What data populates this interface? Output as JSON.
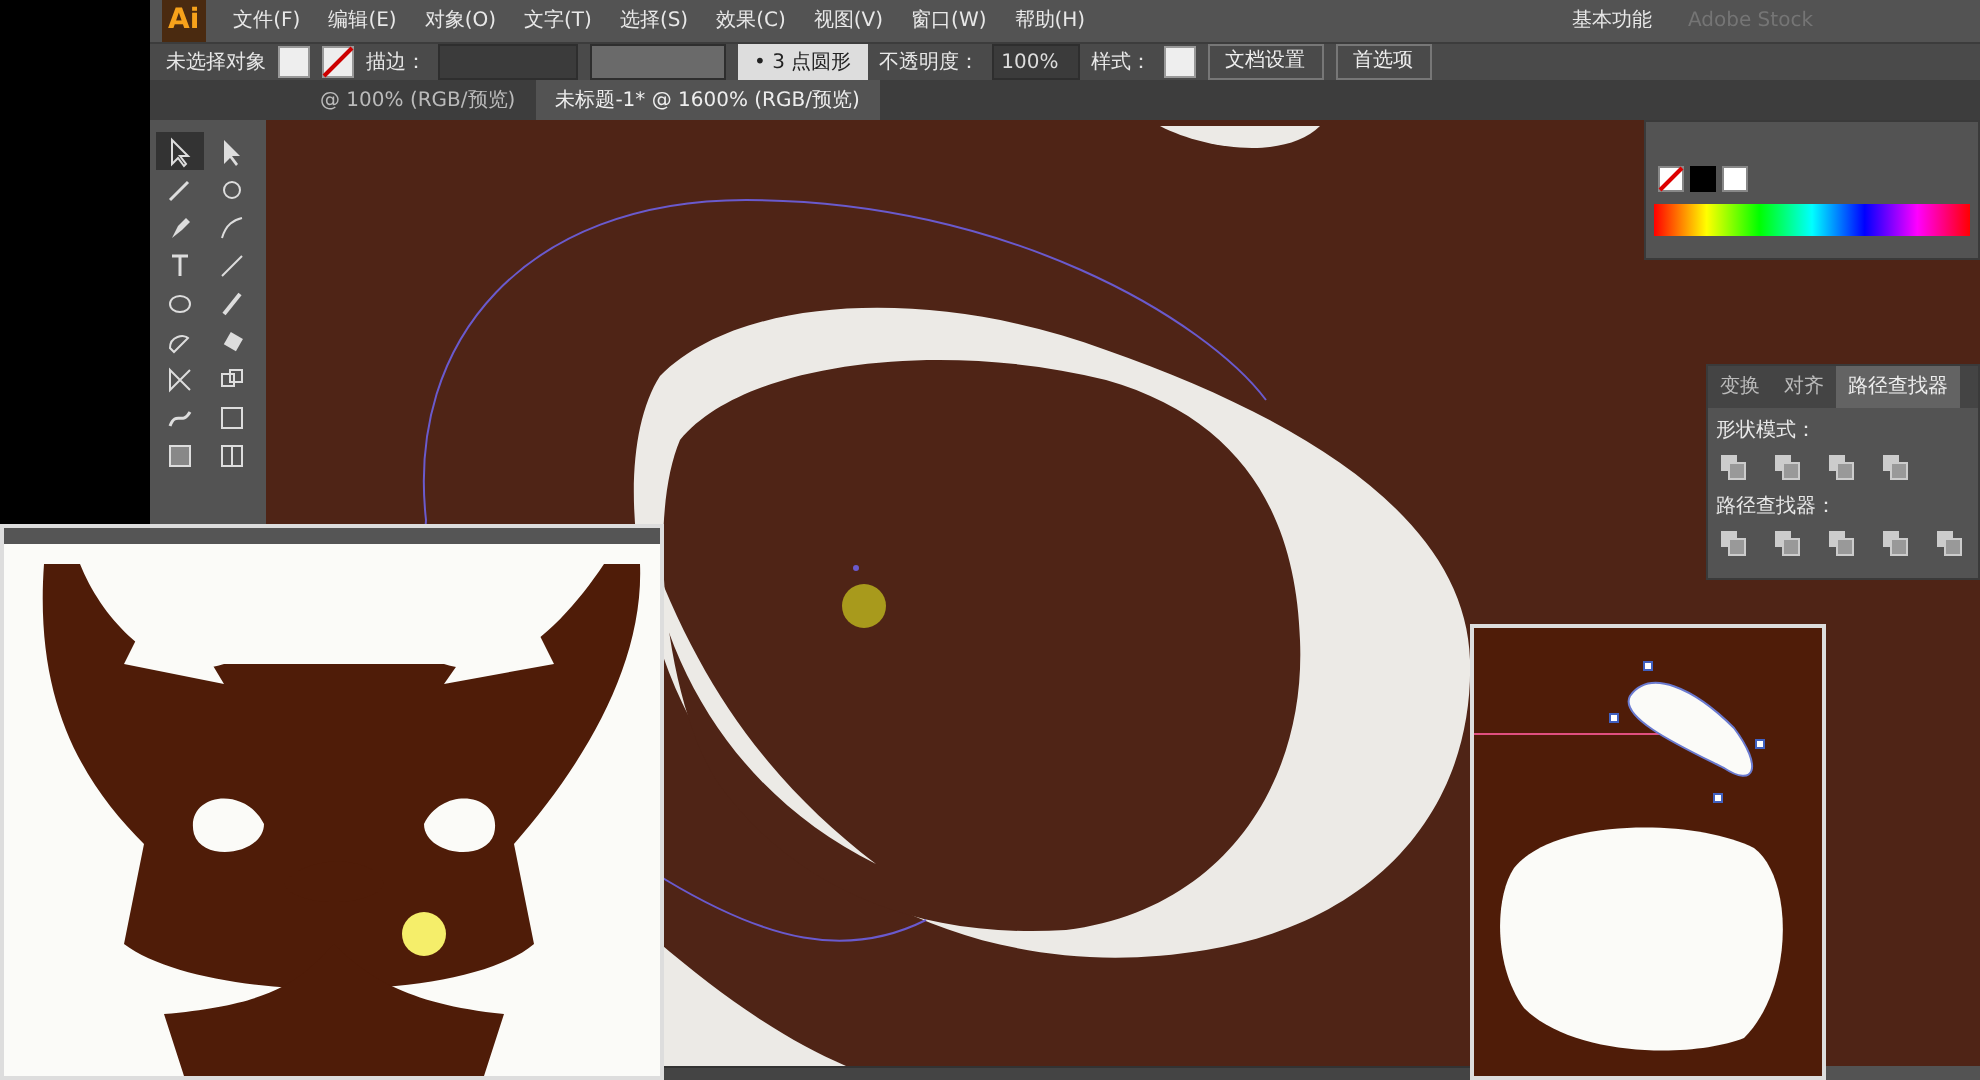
{
  "logo": "Ai",
  "menu": [
    "文件(F)",
    "编辑(E)",
    "对象(O)",
    "文字(T)",
    "选择(S)",
    "效果(C)",
    "视图(V)",
    "窗口(W)",
    "帮助(H)"
  ],
  "workspace": "基本功能",
  "search": {
    "placeholder": "Adobe Stock"
  },
  "control_bar": {
    "selection": "未选择对象",
    "stroke_label": "描边：",
    "brush": "• 3 点圆形",
    "opacity_label": "不透明度：",
    "opacity": "100%",
    "style_label": "样式：",
    "buttons": [
      "文档设置",
      "首选项"
    ]
  },
  "tabs": [
    {
      "label": "@ 100% (RGB/预览)",
      "selected": false
    },
    {
      "label": "未标题-1* @ 1600% (RGB/预览)",
      "selected": true
    }
  ],
  "tools": [
    {
      "selected": true
    },
    {
      "selected": false
    },
    {
      "selected": false
    },
    {
      "selected": false
    },
    {
      "selected": false
    },
    {
      "selected": false
    },
    {
      "selected": false
    },
    {
      "selected": false
    },
    {
      "selected": false
    },
    {
      "selected": false
    },
    {
      "selected": false
    },
    {
      "selected": false
    },
    {
      "selected": false
    },
    {
      "selected": false
    },
    {
      "selected": false
    },
    {
      "selected": false
    },
    {
      "selected": false
    },
    {
      "selected": false
    }
  ],
  "pathfinder_panel": {
    "tabs": [
      {
        "label": "变换",
        "selected": false
      },
      {
        "label": "对齐",
        "selected": false
      },
      {
        "label": "路径查找器",
        "selected": true
      }
    ],
    "sections": [
      {
        "label": "形状模式："
      },
      {
        "label": "路径查找器："
      }
    ]
  }
}
